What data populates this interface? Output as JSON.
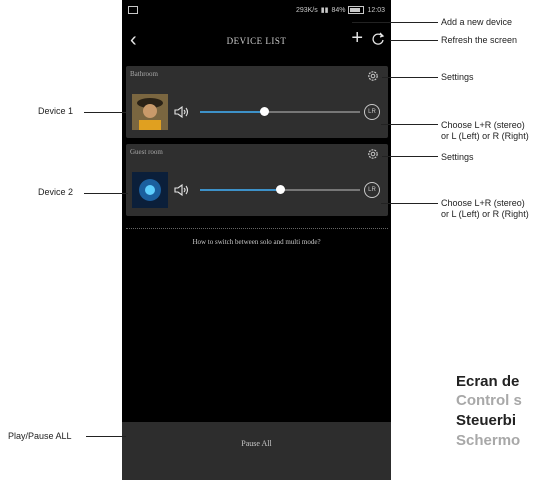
{
  "status_bar": {
    "speed": "293K/s",
    "battery": "84%",
    "time": "12:03"
  },
  "header": {
    "title": "DEVICE LIST"
  },
  "devices": [
    {
      "room": "Bathroom",
      "volume_fraction": 0.4,
      "lr_label": "LR"
    },
    {
      "room": "Guest room",
      "volume_fraction": 0.5,
      "lr_label": "LR"
    }
  ],
  "howto_text": "How to switch between solo and multi mode?",
  "footer": {
    "pause_all": "Pause All"
  },
  "annotations": {
    "add_device": "Add a new device",
    "refresh_screen": "Refresh the screen",
    "settings1": "Settings",
    "device1": "Device 1",
    "choose1_line1": "Choose L+R (stereo)",
    "choose1_line2": "or L (Left) or R (Right)",
    "settings2": "Settings",
    "device2": "Device 2",
    "choose2_line1": "Choose L+R (stereo)",
    "choose2_line2": "or L (Left) or R (Right)",
    "play_pause_all": "Play/Pause ALL"
  },
  "caption": {
    "line1": "Ecran de",
    "line2": "Control s",
    "line3": "Steuerbi",
    "line4": "Schermo"
  },
  "colors": {
    "slider_fill": "#3d91c8",
    "card_bg": "#2f2f2f",
    "phone_bg": "#000000",
    "caption_grey": "#a8a8a8"
  }
}
